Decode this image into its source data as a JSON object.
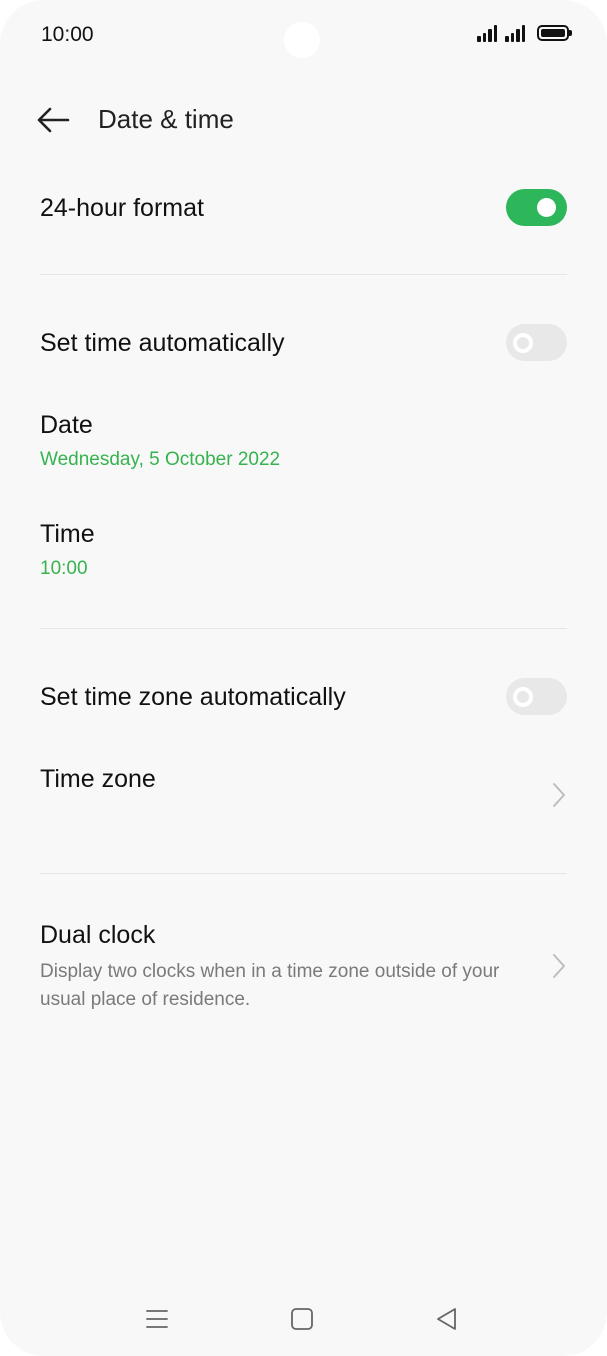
{
  "status_bar": {
    "time": "10:00",
    "icons": [
      "signal-icon",
      "signal-icon",
      "battery-icon"
    ]
  },
  "header": {
    "title": "Date & time",
    "back_icon": "back-arrow-icon"
  },
  "settings": {
    "hour_format": {
      "label": "24-hour format",
      "enabled": true
    },
    "auto_time": {
      "label": "Set time automatically",
      "enabled": false
    },
    "date": {
      "label": "Date",
      "value": "Wednesday, 5 October 2022"
    },
    "time": {
      "label": "Time",
      "value": "10:00"
    },
    "auto_timezone": {
      "label": "Set time zone automatically",
      "enabled": false
    },
    "timezone": {
      "label": "Time zone",
      "icon": "chevron-right-icon"
    },
    "dual_clock": {
      "label": "Dual clock",
      "description": "Display two clocks when in a time zone outside of your usual place of residence.",
      "icon": "chevron-right-icon"
    }
  },
  "nav_bar": {
    "icons": [
      "menu-icon",
      "home-icon",
      "back-icon"
    ]
  },
  "colors": {
    "accent": "#36b34f",
    "toggle_on": "#2eb65a",
    "toggle_off": "#e8e8e8",
    "background": "#f8f8f8"
  }
}
